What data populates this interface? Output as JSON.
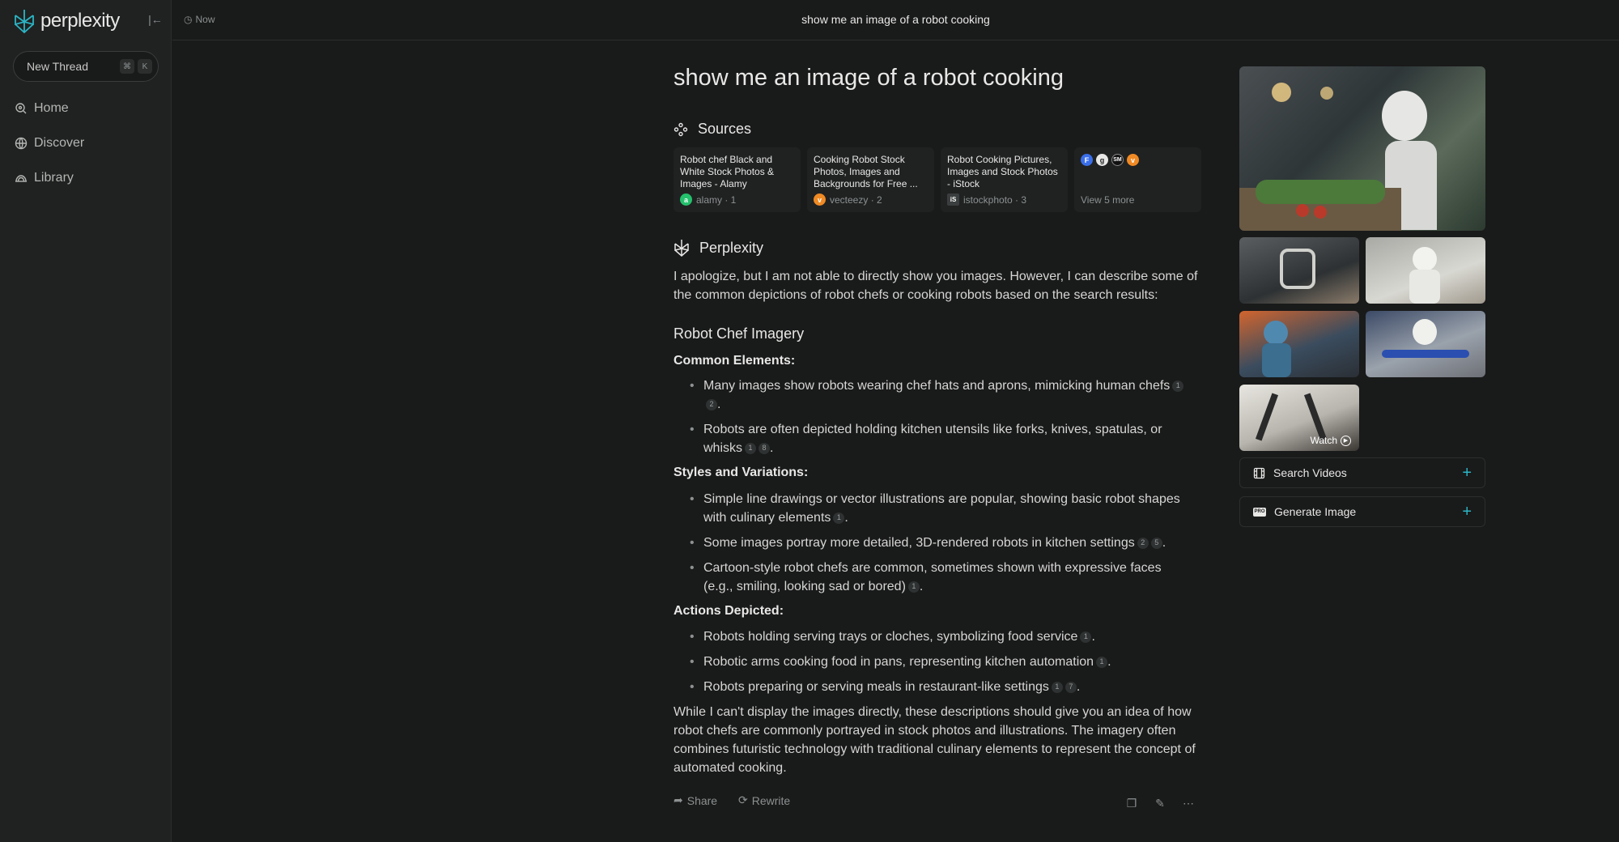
{
  "app": {
    "name": "perplexity"
  },
  "sidebar": {
    "new_thread": "New Thread",
    "shortcut_keys": [
      "⌘",
      "K"
    ],
    "items": [
      {
        "label": "Home",
        "icon": "home-search-icon"
      },
      {
        "label": "Discover",
        "icon": "globe-icon"
      },
      {
        "label": "Library",
        "icon": "library-icon"
      }
    ]
  },
  "topbar": {
    "time": "Now",
    "title": "show me an image of a robot cooking"
  },
  "thread": {
    "question": "show me an image of a robot cooking",
    "sources_heading": "Sources",
    "sources": [
      {
        "title": "Robot chef Black and White Stock Photos & Images - Alamy",
        "site": "alamy · 1",
        "color": "#25c06d",
        "glyph": "a"
      },
      {
        "title": "Cooking Robot Stock Photos, Images and Backgrounds for Free ...",
        "site": "vecteezy · 2",
        "color": "#f08a24",
        "glyph": "v"
      },
      {
        "title": "Robot Cooking Pictures, Images and Stock Photos - iStock",
        "site": "istockphoto · 3",
        "color": "#3b3e3e",
        "glyph": "iS"
      }
    ],
    "view_more": "View 5 more",
    "answer_heading": "Perplexity",
    "intro": "I apologize, but I am not able to directly show you images. However, I can describe some of the common depictions of robot chefs or cooking robots based on the search results:",
    "section_title": "Robot Chef Imagery",
    "common_heading": "Common Elements:",
    "common": [
      {
        "text": "Many images show robots wearing chef hats and aprons, mimicking human chefs",
        "cites": [
          "1",
          "2"
        ],
        "end": "."
      },
      {
        "text": "Robots are often depicted holding kitchen utensils like forks, knives, spatulas, or whisks",
        "cites": [
          "1",
          "8"
        ],
        "end": "."
      }
    ],
    "styles_heading": "Styles and Variations:",
    "styles": [
      {
        "text": "Simple line drawings or vector illustrations are popular, showing basic robot shapes with culinary elements",
        "cites": [
          "1"
        ],
        "end": "."
      },
      {
        "text": "Some images portray more detailed, 3D-rendered robots in kitchen settings",
        "cites": [
          "2",
          "5"
        ],
        "end": "."
      },
      {
        "text": "Cartoon-style robot chefs are common, sometimes shown with expressive faces (e.g., smiling, looking sad or bored)",
        "cites": [
          "1"
        ],
        "end": "."
      }
    ],
    "actions_heading": "Actions Depicted:",
    "actions": [
      {
        "text": "Robots holding serving trays or cloches, symbolizing food service",
        "cites": [
          "1"
        ],
        "end": "."
      },
      {
        "text": "Robotic arms cooking food in pans, representing kitchen automation",
        "cites": [
          "1"
        ],
        "end": "."
      },
      {
        "text": "Robots preparing or serving meals in restaurant-like settings",
        "cites": [
          "1",
          "7"
        ],
        "end": "."
      }
    ],
    "conclusion": "While I can't display the images directly, these descriptions should give you an idea of how robot chefs are commonly portrayed in stock photos and illustrations. The imagery often combines futuristic technology with traditional culinary elements to represent the concept of automated cooking.",
    "share": "Share",
    "rewrite": "Rewrite"
  },
  "right_panel": {
    "watch": "Watch",
    "search_videos": "Search Videos",
    "generate_image": "Generate Image",
    "pro_badge": "PRO"
  },
  "colors": {
    "accent": "#2bb5c5",
    "background": "#191a1a",
    "sidebar": "#202222"
  }
}
